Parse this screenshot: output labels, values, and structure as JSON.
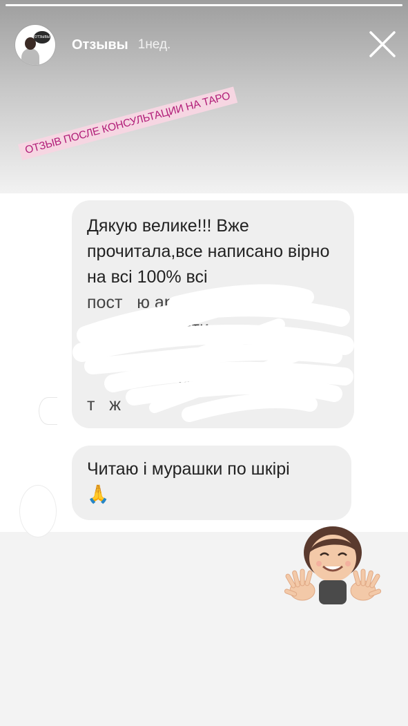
{
  "story": {
    "username": "Отзывы",
    "time": "1нед.",
    "progress": 1.0,
    "avatar_text": "ОТЗЫВЫ"
  },
  "sticker": {
    "text": "ОТЗЫВ ПОСЛЕ КОНСУЛЬТАЦИИ НА ТАРО"
  },
  "messages": [
    {
      "text": "Дякую велике!!! Вже прочитала,все написано вірно на всі 100% всі",
      "hidden_text": "пост   ю ар   ив     і\n        е х       йти\n                   о\n                   се\nт   ж                    "
    },
    {
      "text": "Читаю і мурашки по шкірі",
      "emoji": "🙏"
    }
  ],
  "icons": {
    "close": "close-icon",
    "reply_sticker": "memoji-hands-sticker"
  },
  "colors": {
    "sticker_bg": "#f6d6e2",
    "sticker_text": "#b11d78",
    "bubble_bg": "#efefef"
  }
}
